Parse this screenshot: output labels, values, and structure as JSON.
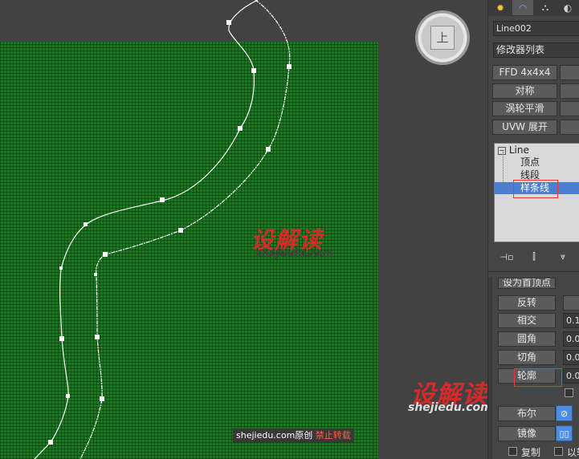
{
  "viewport": {
    "viewcube_face": "上",
    "watermark_logo": "设解读",
    "watermark_url": "shejiedu.com",
    "credit": {
      "site": "shejiedu.com",
      "original": "原创",
      "no_repost": "禁止转载"
    }
  },
  "command_panel": {
    "object_name": "Line002",
    "modifier_list": "修改器列表",
    "modifier_buttons": [
      "FFD 4x4x4",
      "对称",
      "涡轮平滑",
      "UVW 展开"
    ],
    "stack": {
      "root": "Line",
      "children": [
        "顶点",
        "线段",
        "样条线"
      ],
      "selected": "样条线"
    },
    "stack_tool_icons": [
      "pin-stack-icon",
      "show-end-result-icon",
      "make-unique-icon"
    ],
    "geometry": {
      "cut_off_label": "设为首顶点",
      "buttons": [
        "反转",
        "相交",
        "圆角",
        "切角",
        "轮廓"
      ],
      "values": [
        "0.1",
        "0.0",
        "0.0",
        "0.0"
      ],
      "highlighted": "轮廓",
      "boolean_label": "布尔",
      "mirror_label": "镜像",
      "copy_label": "复制",
      "pivot_label": "以轴"
    }
  },
  "colors": {
    "ground": "#1c7a24",
    "selection": "#4a7ed4",
    "highlight_box": "#e83a3a",
    "active_toggle": "#4d8ee0"
  }
}
